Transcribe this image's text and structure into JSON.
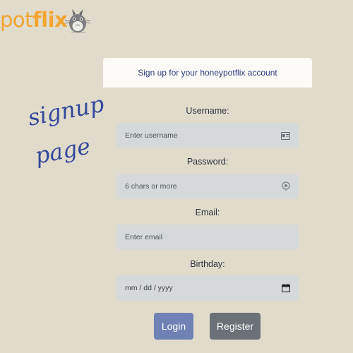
{
  "brand": {
    "prefix": "pot",
    "bold": "flix"
  },
  "scribble": {
    "line1": "signup",
    "line2": "page"
  },
  "form": {
    "title": "Sign up for your honeypotflix account",
    "username": {
      "label": "Username:",
      "placeholder": "Enter username",
      "icon": "id-card-icon"
    },
    "password": {
      "label": "Password:",
      "placeholder": "6 chars or more",
      "icon": "eye-icon"
    },
    "email": {
      "label": "Email:",
      "placeholder": "Enter email"
    },
    "birthday": {
      "label": "Birthday:",
      "placeholder": "mm / dd / yyyy",
      "icon": "calendar-icon"
    }
  },
  "buttons": {
    "login": "Login",
    "register": "Register"
  },
  "colors": {
    "background": "#e0dbcb",
    "brand": "#f2a531",
    "login": "#6f81b5",
    "register": "#6b7176"
  }
}
